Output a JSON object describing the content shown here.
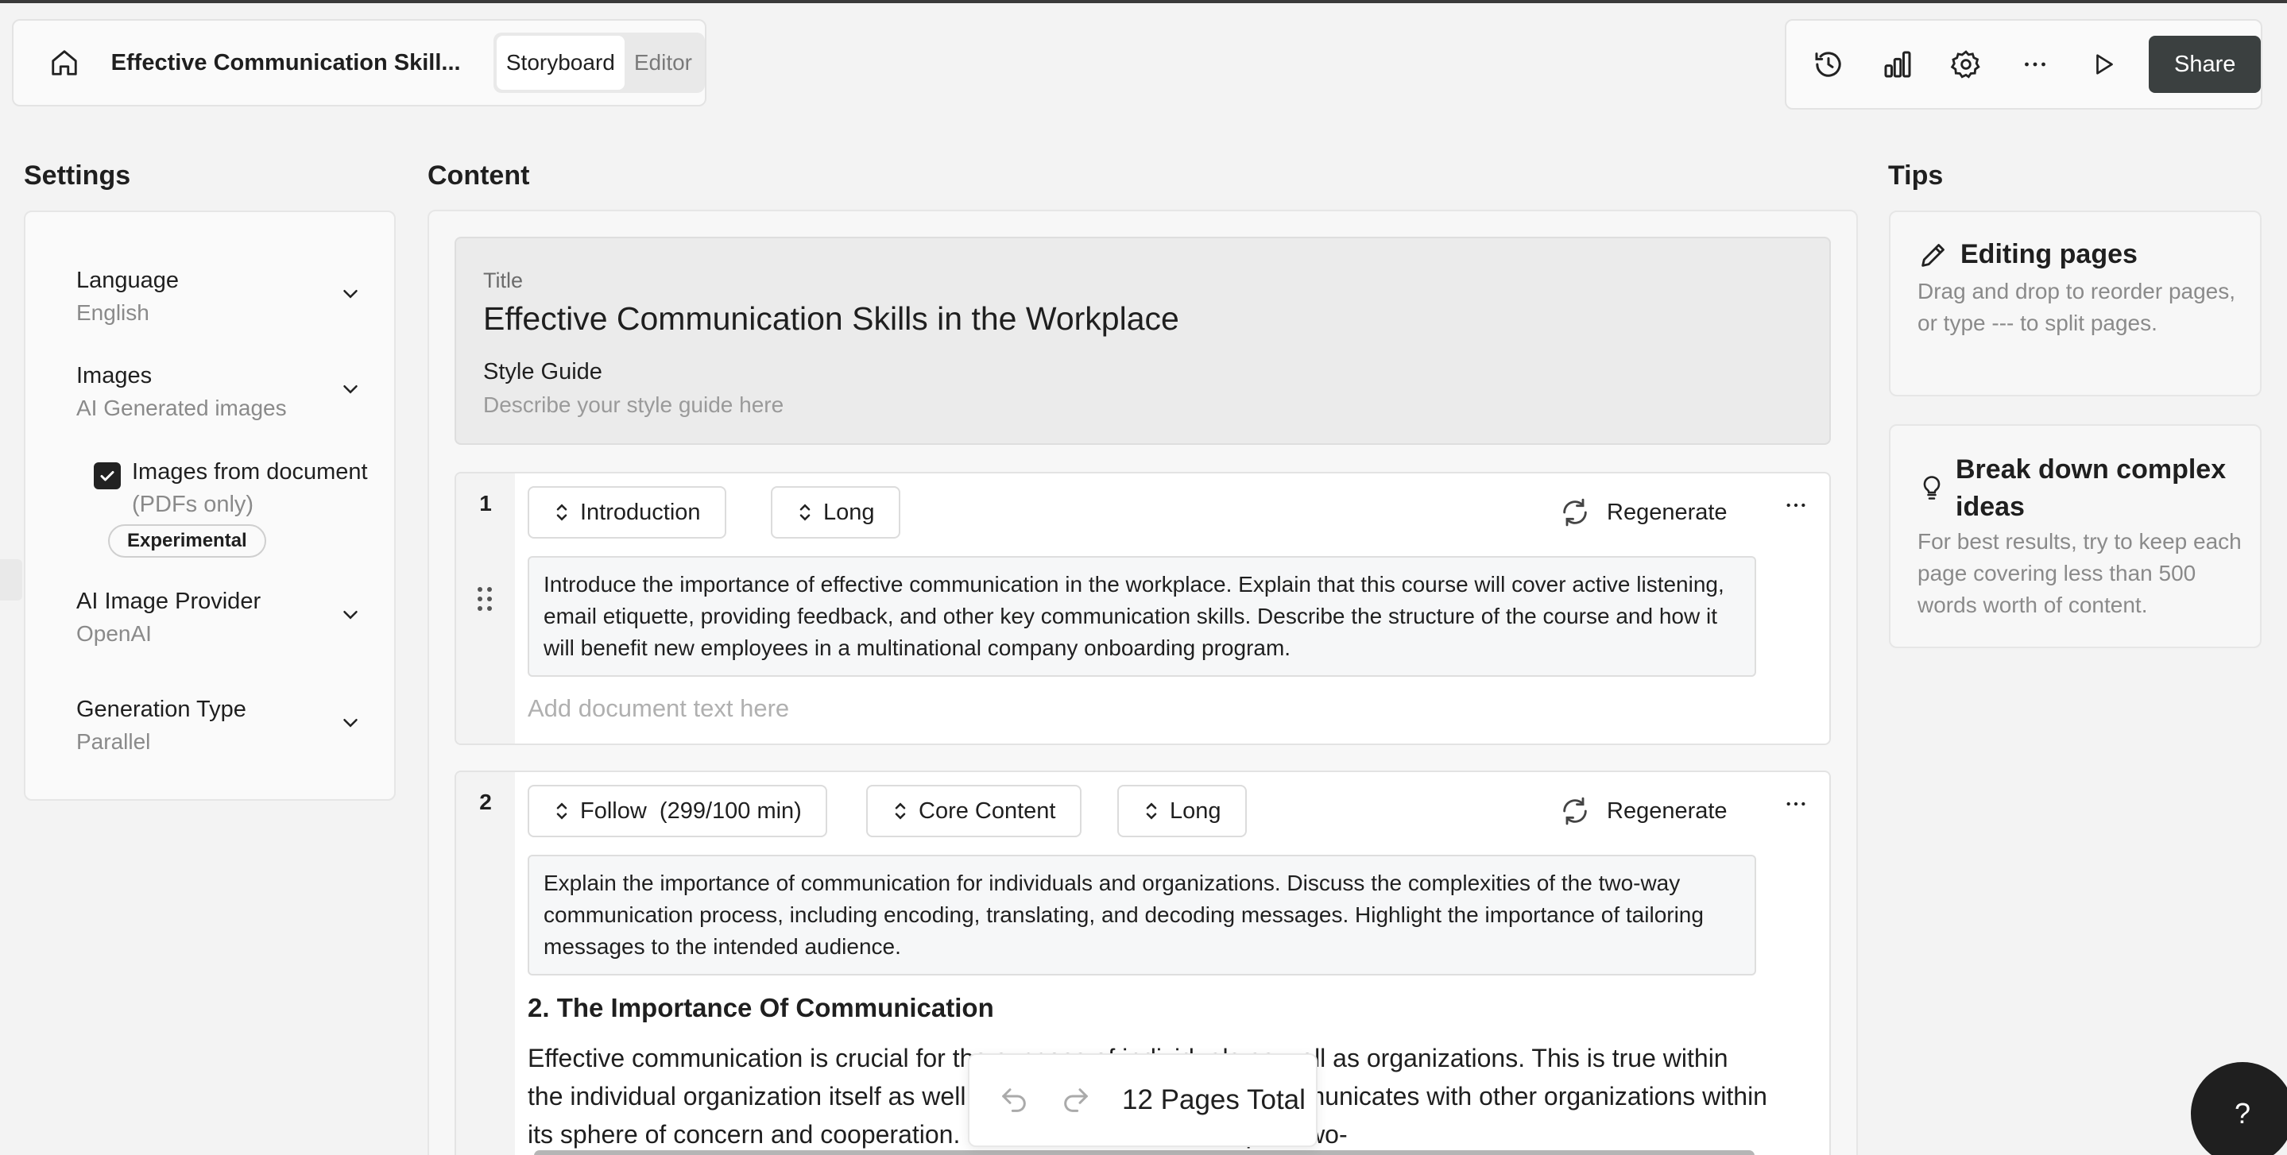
{
  "header": {
    "doc_title": "Effective Communication Skill...",
    "tabs": [
      {
        "label": "Storyboard",
        "active": true
      },
      {
        "label": "Editor",
        "active": false
      }
    ],
    "share_label": "Share",
    "icons": [
      "home-icon",
      "history-icon",
      "analytics-icon",
      "settings-icon",
      "more-icon",
      "play-icon"
    ]
  },
  "sections": {
    "settings": "Settings",
    "content": "Content",
    "tips": "Tips"
  },
  "settings": {
    "language": {
      "label": "Language",
      "value": "English"
    },
    "images": {
      "label": "Images",
      "value": "AI Generated images"
    },
    "images_from_document": {
      "label": "Images from document",
      "sub": "(PDFs only)",
      "checked": true,
      "badge": "Experimental"
    },
    "ai_image_provider": {
      "label": "AI Image Provider",
      "value": "OpenAI"
    },
    "generation_type": {
      "label": "Generation Type",
      "value": "Parallel"
    }
  },
  "content": {
    "title_label": "Title",
    "title_value": "Effective Communication Skills in the Workplace",
    "style_guide_label": "Style Guide",
    "style_guide_placeholder": "Describe your style guide here",
    "pages": [
      {
        "number": "1",
        "pills": [
          "Introduction",
          "Long"
        ],
        "regenerate_label": "Regenerate",
        "prompt": "Introduce the importance of effective communication in the workplace. Explain that this course will cover active listening, email etiquette, providing feedback, and other key communication skills. Describe the structure of the course and how it will benefit new employees in a multinational company onboarding program.",
        "document_placeholder": "Add document text here"
      },
      {
        "number": "2",
        "pills": [
          "Follow  (299/100 min)",
          "Core Content",
          "Long"
        ],
        "regenerate_label": "Regenerate",
        "prompt": "Explain the importance of communication for individuals and organizations. Discuss the complexities of the two-way communication process, including encoding, translating, and decoding messages. Highlight the importance of tailoring messages to the intended audience.",
        "heading": "2. The Importance Of Communication",
        "body": "Effective communication is crucial for the success of individuals as well as organizations. This is true within the individual organization itself as well as when an organization communicates with other organizations within its sphere of concern and cooperation. Communication is a complex two-"
      }
    ]
  },
  "tips": [
    {
      "title": "Editing pages",
      "body": "Drag and drop to reorder pages, or type --- to split pages.",
      "icon": "pencil-icon"
    },
    {
      "title": "Break down complex ideas",
      "body": "For best results, try to keep each page covering less than 500 words worth of content.",
      "icon": "lightbulb-icon"
    }
  ],
  "footer": {
    "pages_total": "12 Pages Total",
    "help_label": "?"
  }
}
